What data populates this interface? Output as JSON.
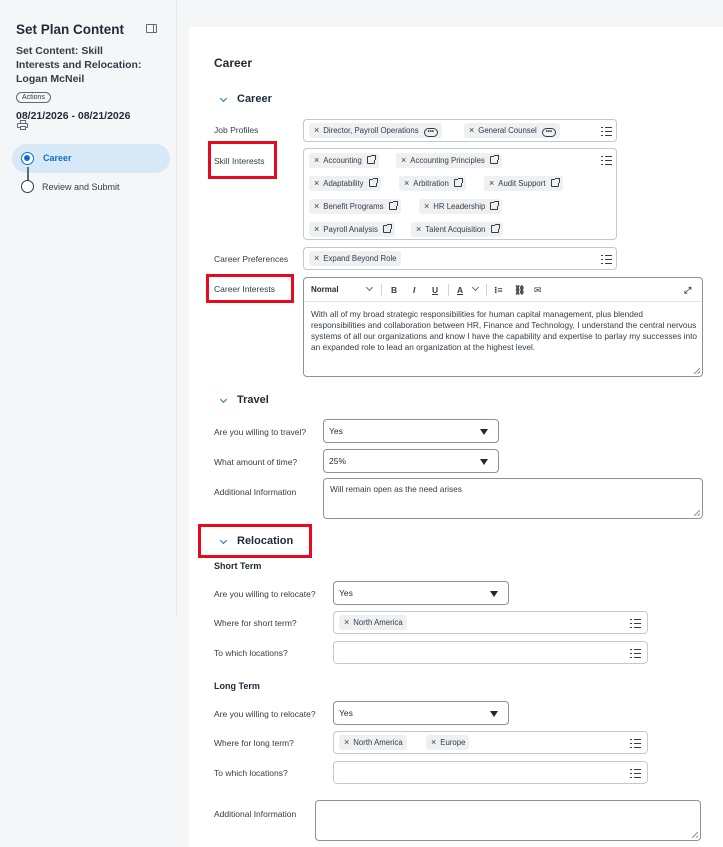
{
  "sidebar": {
    "title": "Set Plan Content",
    "subtitle": "Set Content: Skill Interests and Relocation: Logan McNeil",
    "badge": "Actions",
    "dates": "08/21/2026 - 08/21/2026",
    "steps": [
      {
        "label": "Career",
        "active": true
      },
      {
        "label": "Review and Submit",
        "active": false
      }
    ]
  },
  "main": {
    "heading": "Career",
    "career": {
      "section_title": "Career",
      "job_profiles": {
        "label": "Job Profiles",
        "items": [
          "Director, Payroll Operations",
          "General Counsel"
        ]
      },
      "skill_interests": {
        "label": "Skill Interests",
        "items": [
          "Accounting",
          "Accounting Principles",
          "Adaptability",
          "Arbitration",
          "Audit Support",
          "Benefit Programs",
          "HR Leadership",
          "Payroll Analysis",
          "Talent Acquisition"
        ]
      },
      "career_preferences": {
        "label": "Career Preferences",
        "items": [
          "Expand Beyond Role"
        ]
      },
      "career_interests": {
        "label": "Career Interests",
        "format": "Normal",
        "text": "With all of my broad strategic responsibilities for human capital management, plus blended responsibilities and collaboration between HR, Finance and Technology, I understand the central nervous systems of all our organizations and know I have the capability and expertise to parlay my successes into an expanded role to lead an organization at the highest level."
      }
    },
    "travel": {
      "section_title": "Travel",
      "willing": {
        "label": "Are you willing to travel?",
        "value": "Yes"
      },
      "amount": {
        "label": "What amount of time?",
        "value": "25%"
      },
      "additional": {
        "label": "Additional Information",
        "value": "Will remain open as the need arises"
      }
    },
    "relocation": {
      "section_title": "Relocation",
      "short_term": {
        "title": "Short Term",
        "willing": {
          "label": "Are you willing to relocate?",
          "value": "Yes"
        },
        "where": {
          "label": "Where for short term?",
          "items": [
            "North America"
          ]
        },
        "locations": {
          "label": "To which locations?"
        }
      },
      "long_term": {
        "title": "Long Term",
        "willing": {
          "label": "Are you willing to relocate?",
          "value": "Yes"
        },
        "where": {
          "label": "Where for long term?",
          "items": [
            "North America",
            "Europe"
          ]
        },
        "locations": {
          "label": "To which locations?"
        }
      },
      "additional": {
        "label": "Additional Information",
        "value": ""
      }
    }
  },
  "colors": {
    "accent": "#0b6fcc",
    "highlight": "#e8091e",
    "active_step_bg": "#d7e9f7"
  }
}
